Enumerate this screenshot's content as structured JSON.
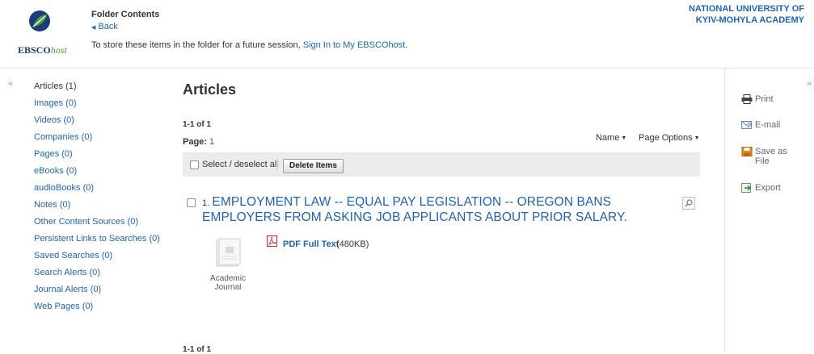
{
  "brand": {
    "logo_bold": "EBSCO",
    "logo_italic": "host"
  },
  "header": {
    "title": "Folder Contents",
    "back": "Back",
    "store_text": "To store these items in the folder for a future session, ",
    "sign_in": "Sign In to My EBSCOhost",
    "store_end": ".",
    "institution_line1": "NATIONAL UNIVERSITY OF",
    "institution_line2": "KYIV-MOHYLA ACADEMY"
  },
  "sidebar": {
    "collapse_left": "«",
    "collapse_right": "»",
    "items": [
      {
        "label": "Articles",
        "count": "(1)"
      },
      {
        "label": "Images",
        "count": "(0)"
      },
      {
        "label": "Videos",
        "count": "(0)"
      },
      {
        "label": "Companies",
        "count": "(0)"
      },
      {
        "label": "Pages",
        "count": "(0)"
      },
      {
        "label": "eBooks",
        "count": "(0)"
      },
      {
        "label": "audioBooks",
        "count": "(0)"
      },
      {
        "label": "Notes",
        "count": "(0)"
      },
      {
        "label": "Other Content Sources",
        "count": "(0)"
      },
      {
        "label": "Persistent Links to Searches",
        "count": "(0)"
      },
      {
        "label": "Saved Searches",
        "count": "(0)"
      },
      {
        "label": "Search Alerts",
        "count": "(0)"
      },
      {
        "label": "Journal Alerts",
        "count": "(0)"
      },
      {
        "label": "Web Pages",
        "count": "(0)"
      }
    ]
  },
  "main": {
    "title": "Articles",
    "results_count": "1-1 of 1",
    "page_label": "Page:",
    "page_number": "1",
    "sort_label": "Name",
    "page_options": "Page Options",
    "select_all": "Select / deselect all",
    "delete_items": "Delete Items",
    "results": [
      {
        "index": "1.",
        "title": "EMPLOYMENT LAW -- EQUAL PAY LEGISLATION -- OREGON BANS EMPLOYERS FROM ASKING JOB APPLICANTS ABOUT PRIOR SALARY.",
        "pub_type_line1": "Academic",
        "pub_type_line2": "Journal",
        "fulltext_label": "PDF Full Text",
        "fulltext_size": "(480KB)"
      }
    ],
    "results_count_bottom": "1-1 of 1"
  },
  "tools": {
    "print": "Print",
    "email": "E-mail",
    "save_line1": "Save as",
    "save_line2": "File",
    "export": "Export"
  },
  "colors": {
    "link": "#1f62b3",
    "toolbar_bg": "#ececec",
    "logo_blue": "#1b3d7a",
    "logo_green": "#4d9c3a"
  }
}
